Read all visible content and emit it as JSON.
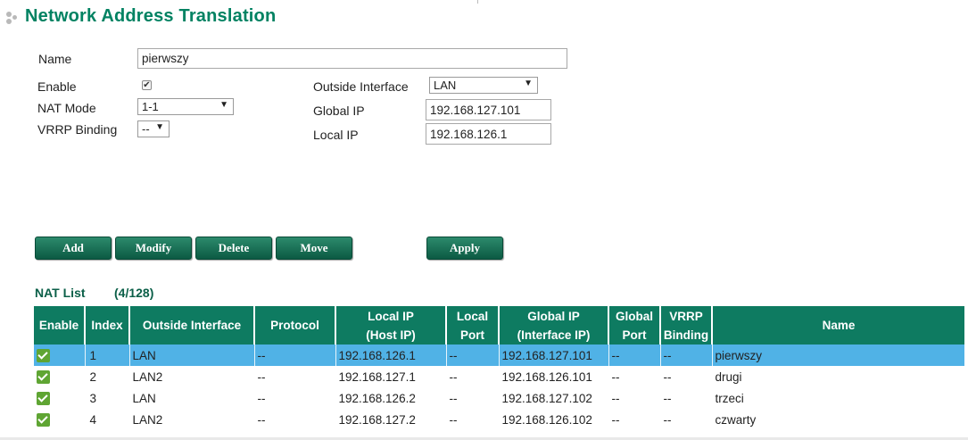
{
  "page": {
    "title": "Network Address Translation"
  },
  "form": {
    "name_label": "Name",
    "name_value": "pierwszy",
    "enable_label": "Enable",
    "enable_checked": true,
    "nat_mode_label": "NAT Mode",
    "nat_mode_value": "1-1",
    "vrrp_label": "VRRP Binding",
    "vrrp_value": "--",
    "outside_interface_label": "Outside Interface",
    "outside_interface_value": "LAN",
    "global_ip_label": "Global IP",
    "global_ip_value": "192.168.127.101",
    "local_ip_label": "Local IP",
    "local_ip_value": "192.168.126.1"
  },
  "buttons": {
    "add": "Add",
    "modify": "Modify",
    "delete": "Delete",
    "move": "Move",
    "apply": "Apply"
  },
  "nat_list": {
    "title": "NAT List",
    "count": "(4/128)",
    "headers": {
      "enable": "Enable",
      "index": "Index",
      "outside_interface": "Outside Interface",
      "protocol": "Protocol",
      "local_ip_1": "Local IP",
      "local_ip_2": "(Host IP)",
      "local_port_1": "Local",
      "local_port_2": "Port",
      "global_ip_1": "Global IP",
      "global_ip_2": "(Interface IP)",
      "global_port_1": "Global",
      "global_port_2": "Port",
      "vrrp_1": "VRRP",
      "vrrp_2": "Binding",
      "name": "Name"
    },
    "rows": [
      {
        "enabled": true,
        "index": "1",
        "outside_interface": "LAN",
        "protocol": "--",
        "local_ip": "192.168.126.1",
        "local_port": "--",
        "global_ip": "192.168.127.101",
        "global_port": "--",
        "vrrp": "--",
        "name": "pierwszy",
        "selected": true
      },
      {
        "enabled": true,
        "index": "2",
        "outside_interface": "LAN2",
        "protocol": "--",
        "local_ip": "192.168.127.1",
        "local_port": "--",
        "global_ip": "192.168.126.101",
        "global_port": "--",
        "vrrp": "--",
        "name": "drugi",
        "selected": false
      },
      {
        "enabled": true,
        "index": "3",
        "outside_interface": "LAN",
        "protocol": "--",
        "local_ip": "192.168.126.2",
        "local_port": "--",
        "global_ip": "192.168.127.102",
        "global_port": "--",
        "vrrp": "--",
        "name": "trzeci",
        "selected": false
      },
      {
        "enabled": true,
        "index": "4",
        "outside_interface": "LAN2",
        "protocol": "--",
        "local_ip": "192.168.127.2",
        "local_port": "--",
        "global_ip": "192.168.126.102",
        "global_port": "--",
        "vrrp": "--",
        "name": "czwarty",
        "selected": false
      }
    ]
  },
  "colors": {
    "title_green": "#008262",
    "header_green": "#0e7b61",
    "selected_row": "#50b2e6",
    "check_green": "#5fa533"
  }
}
